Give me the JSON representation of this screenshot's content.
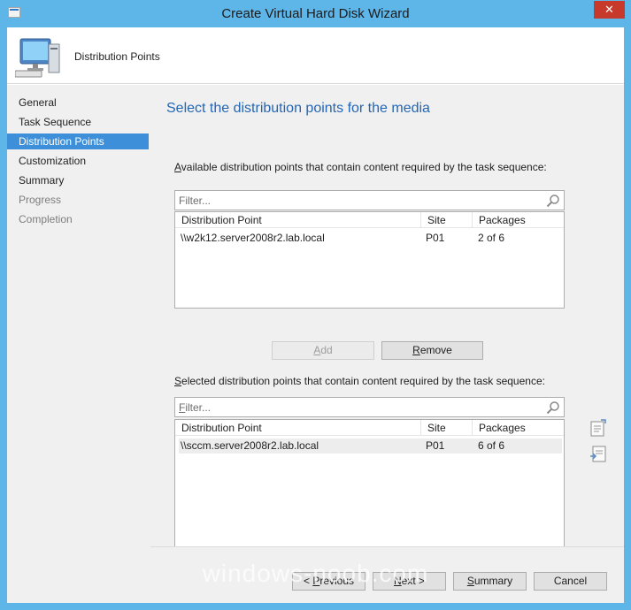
{
  "window": {
    "title": "Create Virtual Hard Disk Wizard",
    "close_symbol": "✕"
  },
  "header": {
    "title": "Distribution Points",
    "icon": "computer-icon"
  },
  "nav": {
    "items": [
      {
        "label": "General",
        "state": "normal"
      },
      {
        "label": "Task Sequence",
        "state": "normal"
      },
      {
        "label": "Distribution Points",
        "state": "active"
      },
      {
        "label": "Customization",
        "state": "normal"
      },
      {
        "label": "Summary",
        "state": "normal"
      },
      {
        "label": "Progress",
        "state": "disabled"
      },
      {
        "label": "Completion",
        "state": "disabled"
      }
    ]
  },
  "main": {
    "page_title": "Select the distribution points for the media",
    "available": {
      "label_prefix": "A",
      "label_rest": "vailable distribution points that contain content required by the task sequence:",
      "filter_placeholder": "Filter...",
      "columns": [
        "Distribution Point",
        "Site",
        "Packages"
      ],
      "rows": [
        {
          "point": "\\\\w2k12.server2008r2.lab.local",
          "site": "P01",
          "packages": "2 of 6"
        }
      ]
    },
    "add_label": {
      "u": "A",
      "rest": "dd"
    },
    "remove_label": {
      "u": "R",
      "rest": "emove"
    },
    "selected": {
      "label_prefix": "S",
      "label_rest": "elected distribution points that contain content required by the task sequence:",
      "filter_placeholder": {
        "u": "F",
        "rest": "ilter..."
      },
      "columns": [
        "Distribution Point",
        "Site",
        "Packages"
      ],
      "rows": [
        {
          "point": "\\\\sccm.server2008r2.lab.local",
          "site": "P01",
          "packages": "6 of 6"
        }
      ]
    }
  },
  "footer": {
    "previous": {
      "pre": "< ",
      "u": "P",
      "rest": "revious"
    },
    "next": {
      "u": "N",
      "rest": "ext >"
    },
    "summary": {
      "u": "S",
      "rest": "ummary"
    },
    "cancel": "Cancel"
  },
  "watermark": "windows-noob.com",
  "colors": {
    "title_bar": "#5eb5e8",
    "accent": "#3c8fd8",
    "page_title": "#2466b4",
    "close": "#c7392b"
  }
}
